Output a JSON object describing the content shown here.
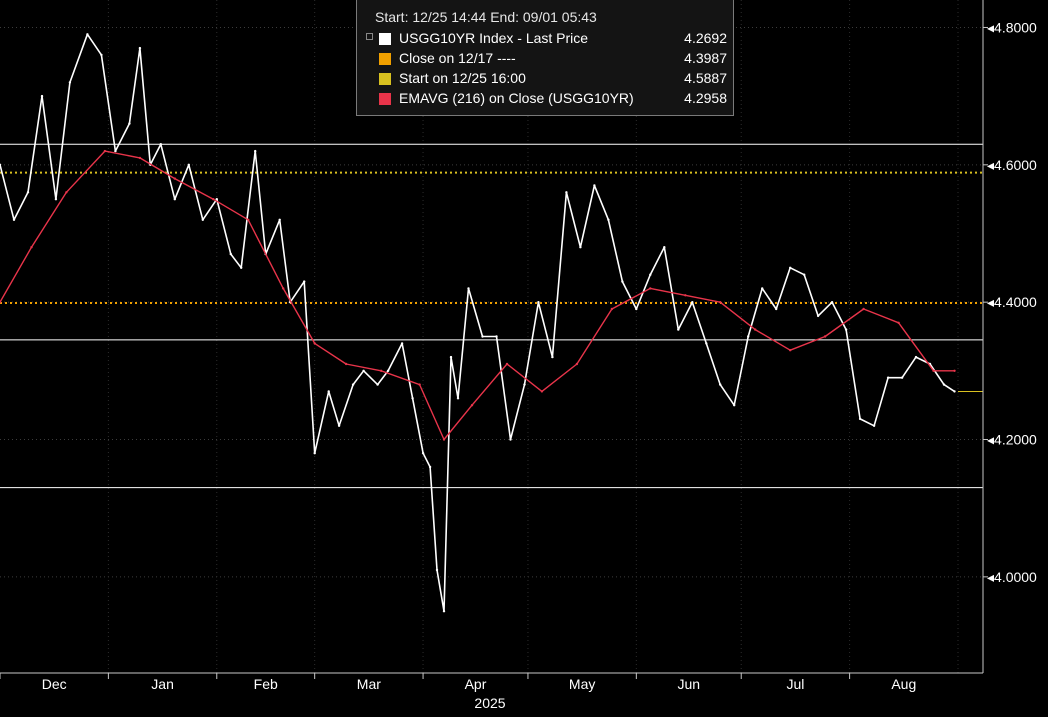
{
  "chart_data": {
    "type": "line",
    "title": "",
    "ylim": [
      3.86,
      4.84
    ],
    "grid": true,
    "y_ticks": [
      {
        "value": 4.8,
        "label": "4.8000"
      },
      {
        "value": 4.6,
        "label": "4.6000"
      },
      {
        "value": 4.4,
        "label": "4.4000"
      },
      {
        "value": 4.2,
        "label": "4.2000"
      },
      {
        "value": 4.0,
        "label": "4.0000"
      }
    ],
    "x_ticks": [
      "Dec",
      "Jan",
      "Feb",
      "Mar",
      "Apr",
      "May",
      "Jun",
      "Jul",
      "Aug"
    ],
    "x_year_label": "2025",
    "x_range": [
      "2024-12-01",
      "2025-09-01"
    ],
    "legend": {
      "placement": "top-center",
      "header": "Start: 12/25 14:44 End: 09/01 05:43",
      "entries": [
        {
          "name": "USGG10YR Index - Last Price",
          "value": "4.2692",
          "color": "#ffffff"
        },
        {
          "name": "Close on 12/17 ----",
          "value": "4.3987",
          "color": "#f0a000"
        },
        {
          "name": "Start on 12/25 16:00",
          "value": "4.5887",
          "color": "#d8c020"
        },
        {
          "name": "EMAVG (216)  on Close (USGG10YR)",
          "value": "4.2958",
          "color": "#e8344a"
        }
      ]
    },
    "reference_lines": [
      {
        "value": 4.3987,
        "color": "#f0a000",
        "style": "dotted"
      },
      {
        "value": 4.5887,
        "color": "#d8c020",
        "style": "dotted"
      },
      {
        "value": 4.63,
        "color": "#ffffff",
        "style": "solid"
      },
      {
        "value": 4.345,
        "color": "#ffffff",
        "style": "solid"
      },
      {
        "value": 4.13,
        "color": "#ffffff",
        "style": "solid"
      }
    ],
    "series": [
      {
        "name": "USGG10YR Index - Last Price",
        "color": "#ffffff",
        "x": [
          "2024-12-01",
          "2024-12-05",
          "2024-12-09",
          "2024-12-13",
          "2024-12-17",
          "2024-12-21",
          "2024-12-26",
          "2024-12-30",
          "2025-01-03",
          "2025-01-07",
          "2025-01-10",
          "2025-01-13",
          "2025-01-16",
          "2025-01-20",
          "2025-01-24",
          "2025-01-28",
          "2025-02-01",
          "2025-02-05",
          "2025-02-08",
          "2025-02-12",
          "2025-02-15",
          "2025-02-19",
          "2025-02-22",
          "2025-02-26",
          "2025-03-01",
          "2025-03-05",
          "2025-03-08",
          "2025-03-12",
          "2025-03-15",
          "2025-03-19",
          "2025-03-22",
          "2025-03-26",
          "2025-03-29",
          "2025-04-01",
          "2025-04-03",
          "2025-04-05",
          "2025-04-07",
          "2025-04-09",
          "2025-04-11",
          "2025-04-14",
          "2025-04-18",
          "2025-04-22",
          "2025-04-26",
          "2025-04-30",
          "2025-05-04",
          "2025-05-08",
          "2025-05-12",
          "2025-05-16",
          "2025-05-20",
          "2025-05-24",
          "2025-05-28",
          "2025-06-01",
          "2025-06-05",
          "2025-06-09",
          "2025-06-13",
          "2025-06-17",
          "2025-06-21",
          "2025-06-25",
          "2025-06-29",
          "2025-07-03",
          "2025-07-07",
          "2025-07-11",
          "2025-07-15",
          "2025-07-19",
          "2025-07-23",
          "2025-07-27",
          "2025-07-31",
          "2025-08-04",
          "2025-08-08",
          "2025-08-12",
          "2025-08-16",
          "2025-08-20",
          "2025-08-24",
          "2025-08-28",
          "2025-08-31"
        ],
        "values": [
          4.6,
          4.52,
          4.56,
          4.7,
          4.55,
          4.72,
          4.79,
          4.76,
          4.62,
          4.66,
          4.77,
          4.6,
          4.63,
          4.55,
          4.6,
          4.52,
          4.55,
          4.47,
          4.45,
          4.62,
          4.47,
          4.52,
          4.4,
          4.43,
          4.18,
          4.27,
          4.22,
          4.28,
          4.3,
          4.28,
          4.3,
          4.34,
          4.26,
          4.18,
          4.16,
          4.01,
          3.95,
          4.32,
          4.26,
          4.42,
          4.35,
          4.35,
          4.2,
          4.28,
          4.4,
          4.32,
          4.56,
          4.48,
          4.57,
          4.52,
          4.43,
          4.39,
          4.44,
          4.48,
          4.36,
          4.4,
          4.34,
          4.28,
          4.25,
          4.35,
          4.42,
          4.39,
          4.45,
          4.44,
          4.38,
          4.4,
          4.36,
          4.23,
          4.22,
          4.29,
          4.29,
          4.32,
          4.31,
          4.28,
          4.27
        ]
      },
      {
        "name": "EMAVG (216)  on Close (USGG10YR)",
        "color": "#e8344a",
        "x": [
          "2024-12-01",
          "2024-12-10",
          "2024-12-20",
          "2024-12-31",
          "2025-01-10",
          "2025-01-20",
          "2025-01-31",
          "2025-02-10",
          "2025-02-20",
          "2025-03-01",
          "2025-03-10",
          "2025-03-20",
          "2025-03-31",
          "2025-04-07",
          "2025-04-15",
          "2025-04-25",
          "2025-05-05",
          "2025-05-15",
          "2025-05-25",
          "2025-06-05",
          "2025-06-15",
          "2025-06-25",
          "2025-07-05",
          "2025-07-15",
          "2025-07-25",
          "2025-08-05",
          "2025-08-15",
          "2025-08-25",
          "2025-08-31"
        ],
        "values": [
          4.4,
          4.48,
          4.56,
          4.62,
          4.61,
          4.58,
          4.55,
          4.52,
          4.42,
          4.34,
          4.31,
          4.3,
          4.28,
          4.2,
          4.25,
          4.31,
          4.27,
          4.31,
          4.39,
          4.42,
          4.41,
          4.4,
          4.36,
          4.33,
          4.35,
          4.39,
          4.37,
          4.3,
          4.3
        ]
      }
    ]
  }
}
